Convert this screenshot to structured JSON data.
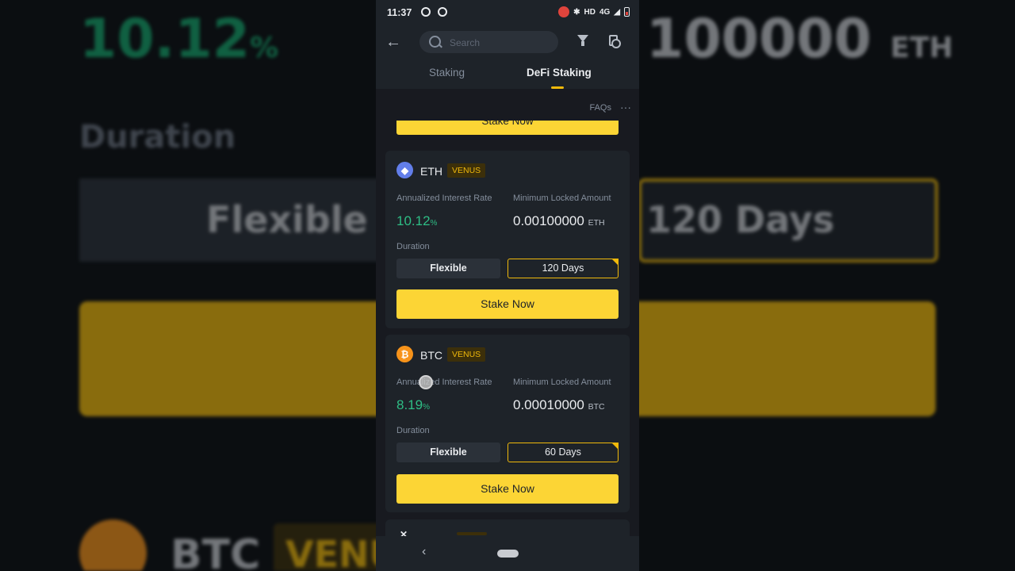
{
  "background": {
    "rate_value": "10.12",
    "rate_unit": "%",
    "amount_value": "100000",
    "amount_unit": "ETH",
    "duration_label": "Duration",
    "flexible_label": "Flexible",
    "days_label": "120 Days",
    "coin_label": "BTC",
    "badge_label": "VENU"
  },
  "status_bar": {
    "time": "11:37",
    "network": "HD",
    "signal": "4G"
  },
  "header": {
    "search_placeholder": "Search",
    "tabs": [
      {
        "label": "Staking",
        "active": false
      },
      {
        "label": "DeFi Staking",
        "active": true
      }
    ],
    "faqs_label": "FAQs",
    "more_label": "···"
  },
  "colors": {
    "accent": "#fcd535",
    "positive": "#2ebd85",
    "card": "#1e2329",
    "page": "#181a20"
  },
  "previous_card": {
    "stake_label": "Stake Now"
  },
  "cards": [
    {
      "asset": "ETH",
      "icon": "ethereum-icon",
      "badge": "VENUS",
      "rate_label": "Annualized Interest Rate",
      "rate": "10.12",
      "rate_unit": "%",
      "min_label": "Minimum Locked Amount",
      "min_amount": "0.00100000",
      "min_unit": "ETH",
      "duration_label": "Duration",
      "option_flexible": "Flexible",
      "option_selected": "120 Days",
      "stake_label": "Stake Now"
    },
    {
      "asset": "BTC",
      "icon": "bitcoin-icon",
      "badge": "VENUS",
      "rate_label": "Annualized Interest Rate",
      "rate": "8.19",
      "rate_unit": "%",
      "min_label": "Minimum Locked Amount",
      "min_amount": "0.00010000",
      "min_unit": "BTC",
      "duration_label": "Duration",
      "option_flexible": "Flexible",
      "option_selected": "60 Days",
      "stake_label": "Stake Now"
    }
  ]
}
